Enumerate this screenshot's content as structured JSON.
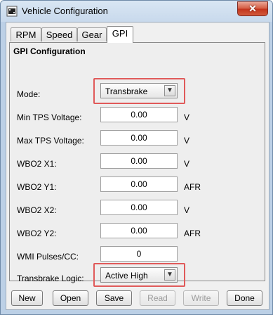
{
  "window": {
    "title": "Vehicle Configuration",
    "close_glyph": "✕"
  },
  "tabs": [
    {
      "label": "RPM",
      "active": false
    },
    {
      "label": "Speed",
      "active": false
    },
    {
      "label": "Gear",
      "active": false
    },
    {
      "label": "GPI",
      "active": true
    }
  ],
  "section": {
    "title": "GPI Configuration"
  },
  "fields": {
    "mode": {
      "label": "Mode:",
      "value": "Transbrake"
    },
    "min_tps": {
      "label": "Min TPS Voltage:",
      "value": "0.00",
      "unit": "V"
    },
    "max_tps": {
      "label": "Max TPS Voltage:",
      "value": "0.00",
      "unit": "V"
    },
    "wbo2_x1": {
      "label": "WBO2 X1:",
      "value": "0.00",
      "unit": "V"
    },
    "wbo2_y1": {
      "label": "WBO2 Y1:",
      "value": "0.00",
      "unit": "AFR"
    },
    "wbo2_x2": {
      "label": "WBO2 X2:",
      "value": "0.00",
      "unit": "V"
    },
    "wbo2_y2": {
      "label": "WBO2 Y2:",
      "value": "0.00",
      "unit": "AFR"
    },
    "wmi": {
      "label": "WMI Pulses/CC:",
      "value": "0"
    },
    "transbrake_logic": {
      "label": "Transbrake Logic:",
      "value": "Active High"
    }
  },
  "buttons": {
    "new": "New",
    "open": "Open",
    "save": "Save",
    "read": "Read",
    "write": "Write",
    "done": "Done"
  },
  "colors": {
    "highlight": "#e05a5a",
    "close_button": "#c2331b"
  }
}
